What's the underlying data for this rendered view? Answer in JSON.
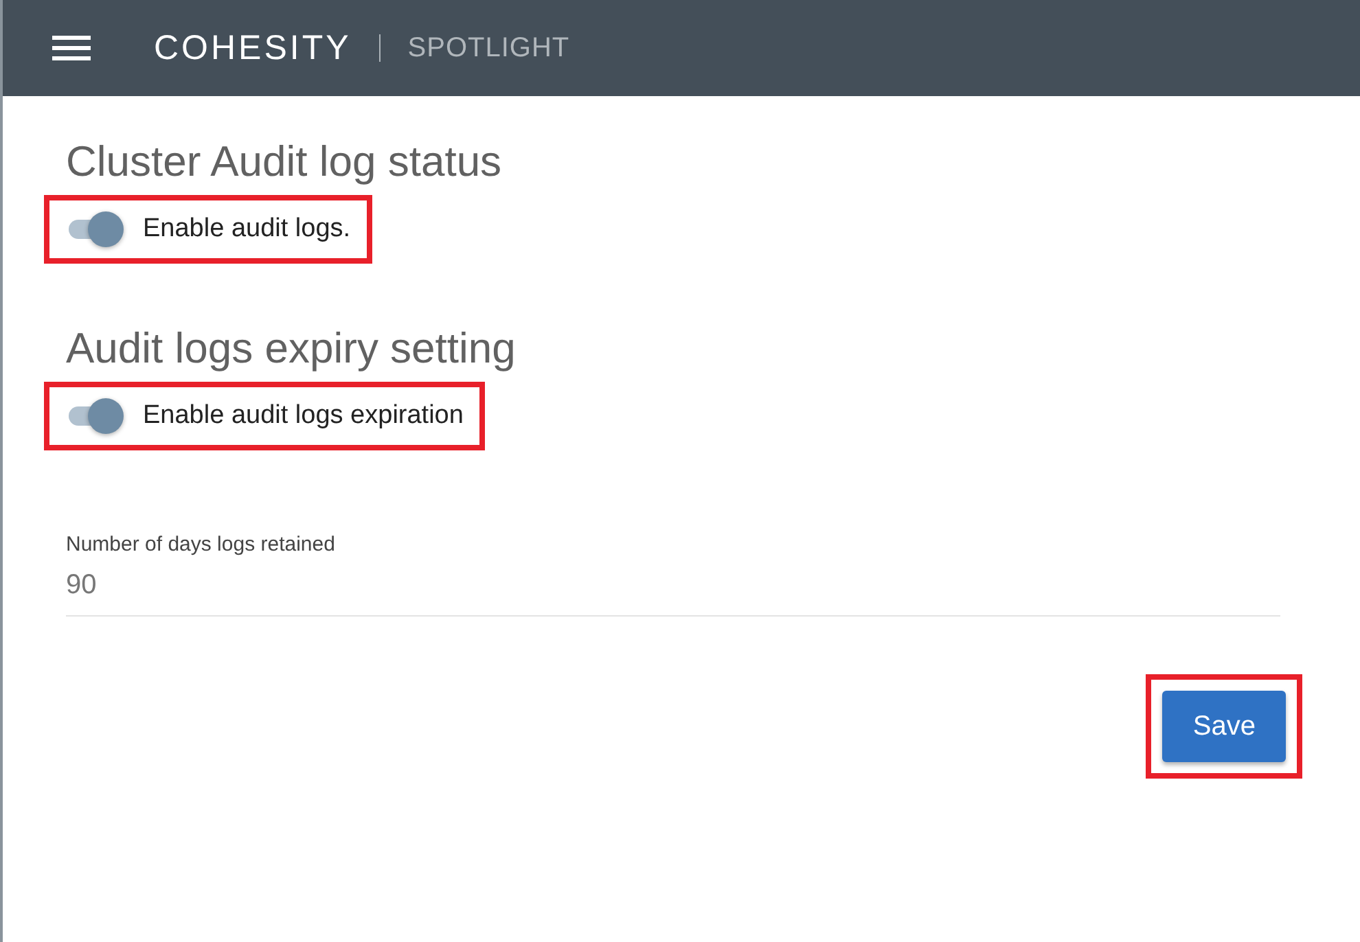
{
  "header": {
    "logo": "COHESITY",
    "product": "SPOTLIGHT"
  },
  "sections": [
    {
      "title": "Cluster Audit log status",
      "toggle": {
        "label": "Enable audit logs.",
        "on": true,
        "highlighted": true
      }
    },
    {
      "title": "Audit logs expiry setting",
      "toggle": {
        "label": "Enable audit logs expiration",
        "on": true,
        "highlighted": true
      }
    }
  ],
  "field": {
    "label": "Number of days logs retained",
    "value": "90"
  },
  "save_button": {
    "label": "Save",
    "highlighted": true
  }
}
